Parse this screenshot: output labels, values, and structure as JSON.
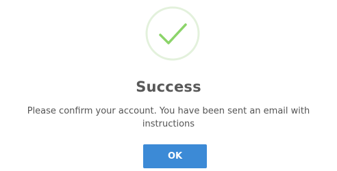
{
  "dialog": {
    "icon": "checkmark-circle-icon",
    "title": "Success",
    "message": "Please confirm your account. You have been sent an email with instructions",
    "ok_label": "OK"
  },
  "colors": {
    "success_ring": "#e3f1dc",
    "success_check": "#8cd46a",
    "button_bg": "#3c8ad6",
    "button_text": "#ffffff",
    "title_text": "#585858",
    "message_text": "#545454"
  }
}
